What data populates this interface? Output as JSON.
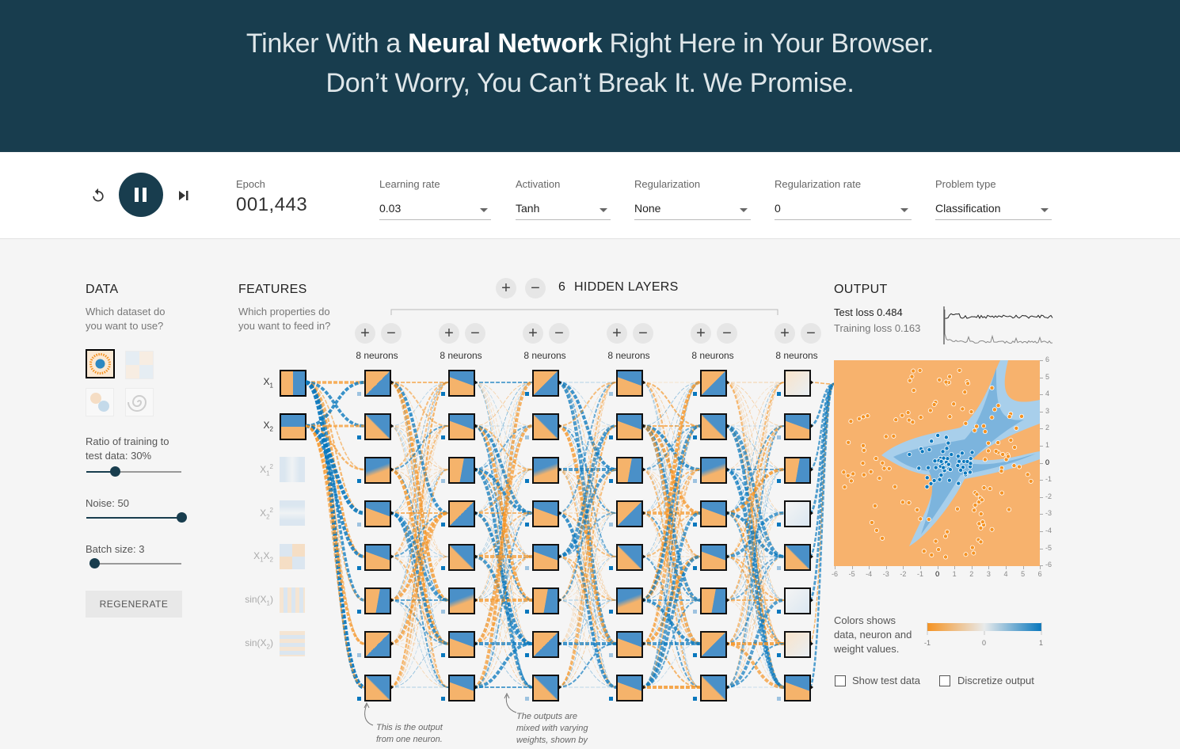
{
  "hero": {
    "line1_pre": "Tinker With a ",
    "line1_bold": "Neural Network",
    "line1_post": " Right Here in Your Browser.",
    "line2": "Don’t Worry, You Can’t Break It. We Promise."
  },
  "controls": {
    "reset_icon": "reset-icon",
    "play_icon": "pause-icon",
    "step_icon": "step-icon",
    "epoch_label": "Epoch",
    "epoch_value": "001,443",
    "learning_rate_label": "Learning rate",
    "learning_rate_value": "0.03",
    "activation_label": "Activation",
    "activation_value": "Tanh",
    "regularization_label": "Regularization",
    "regularization_value": "None",
    "regularization_rate_label": "Regularization rate",
    "regularization_rate_value": "0",
    "problem_type_label": "Problem type",
    "problem_type_value": "Classification"
  },
  "data_panel": {
    "title": "DATA",
    "question": "Which dataset do you want to use?",
    "question_l1": "Which dataset do",
    "question_l2": "you want to use?",
    "ratio_label_l1": "Ratio of training to",
    "ratio_label_l2": "test data:  30%",
    "ratio_value": 0.3,
    "noise_label": "Noise:  50",
    "noise_value": 1.0,
    "batch_label": "Batch size:  3",
    "batch_value": 0.05,
    "regenerate_label": "REGENERATE"
  },
  "features_panel": {
    "title": "FEATURES",
    "question_l1": "Which properties do",
    "question_l2": "you want to feed in?",
    "features": [
      {
        "label": "X",
        "sub": "1",
        "sup": "",
        "tail": "",
        "active": true
      },
      {
        "label": "X",
        "sub": "2",
        "sup": "",
        "tail": "",
        "active": true
      },
      {
        "label": "X",
        "sub": "1",
        "sup": "2",
        "tail": "",
        "active": false
      },
      {
        "label": "X",
        "sub": "2",
        "sup": "2",
        "tail": "",
        "active": false
      },
      {
        "label": "X",
        "sub": "1",
        "sup": "",
        "tail": "X2",
        "active": false
      },
      {
        "label": "sin(X",
        "sub": "1",
        "sup": "",
        "tail": ")",
        "active": false
      },
      {
        "label": "sin(X",
        "sub": "2",
        "sup": "",
        "tail": ")",
        "active": false
      }
    ]
  },
  "network": {
    "hidden_layers_count": "6",
    "hidden_layers_label": "HIDDEN LAYERS",
    "plus": "+",
    "minus": "−",
    "layers": [
      {
        "neurons_label": "8 neurons"
      },
      {
        "neurons_label": "8 neurons"
      },
      {
        "neurons_label": "8 neurons"
      },
      {
        "neurons_label": "8 neurons"
      },
      {
        "neurons_label": "8 neurons"
      },
      {
        "neurons_label": "8 neurons"
      }
    ],
    "note1": [
      "This is the output",
      "from one neuron."
    ],
    "note2": [
      "The outputs are",
      "mixed with varying",
      "weights, shown by"
    ]
  },
  "output_panel": {
    "title": "OUTPUT",
    "test_loss": "Test loss 0.484",
    "training_loss": "Training loss 0.163",
    "x_ticks": [
      "-6",
      "-5",
      "-4",
      "-3",
      "-2",
      "-1",
      "0",
      "1",
      "2",
      "3",
      "4",
      "5",
      "6"
    ],
    "y_ticks": [
      "6",
      "5",
      "4",
      "3",
      "2",
      "1",
      "0",
      "-1",
      "-2",
      "-3",
      "-4",
      "-5",
      "-6"
    ],
    "legend_text_l1": "Colors shows",
    "legend_text_l2": "data, neuron and",
    "legend_text_l3": "weight values.",
    "legend_min": "-1",
    "legend_mid": "0",
    "legend_max": "1",
    "show_test_data": "Show test data",
    "discretize_output": "Discretize output"
  },
  "colors": {
    "orange": "#f59322",
    "blue": "#0877bd",
    "dark": "#183d4e"
  }
}
